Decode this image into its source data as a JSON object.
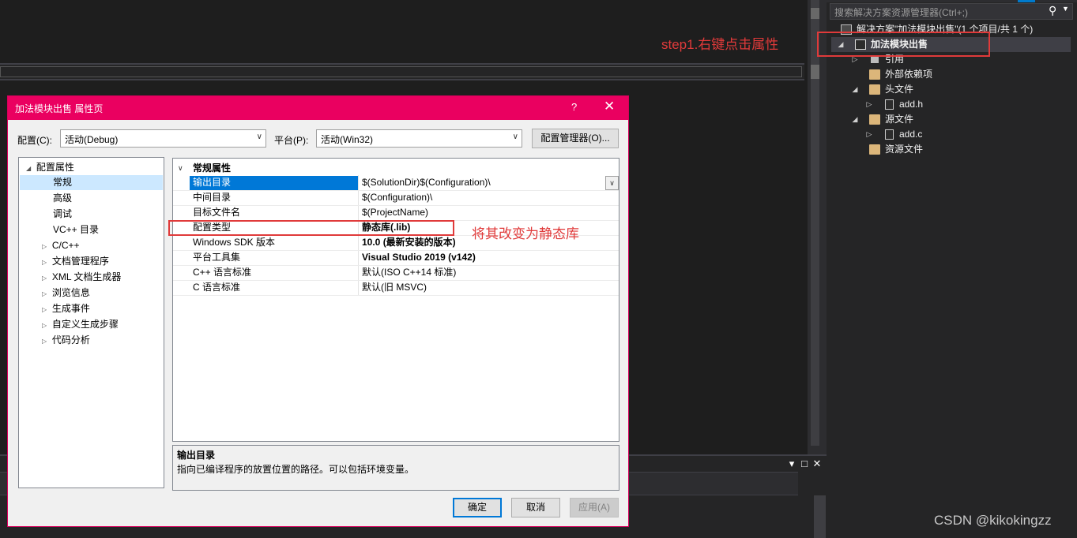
{
  "solution_explorer": {
    "search_placeholder": "搜索解决方案资源管理器(Ctrl+;)",
    "items": [
      {
        "label": "解决方案\"加法模块出售\"(1 个项目/共 1 个)"
      },
      {
        "label": "加法模块出售"
      },
      {
        "label": "引用"
      },
      {
        "label": "外部依赖项"
      },
      {
        "label": "头文件"
      },
      {
        "label": "add.h"
      },
      {
        "label": "源文件"
      },
      {
        "label": "add.c"
      },
      {
        "label": "资源文件"
      }
    ]
  },
  "annotations": {
    "step1": "step1.右键点击属性",
    "change": "将其改变为静态库"
  },
  "watermark": "CSDN @kikokingzz",
  "panel_buttons": {
    "dropdown": "▾",
    "maximize": "□",
    "close": "✕"
  },
  "dialog": {
    "title": "加法模块出售 属性页",
    "help": "?",
    "close": "✕",
    "config_label": "配置(C):",
    "config_value": "活动(Debug)",
    "platform_label": "平台(P):",
    "platform_value": "活动(Win32)",
    "config_manager": "配置管理器(O)...",
    "tree": [
      "配置属性",
      "常规",
      "高级",
      "调试",
      "VC++ 目录",
      "C/C++",
      "文档管理程序",
      "XML 文档生成器",
      "浏览信息",
      "生成事件",
      "自定义生成步骤",
      "代码分析"
    ],
    "grid_category": "常规属性",
    "grid_rows": [
      {
        "name": "输出目录",
        "value": "$(SolutionDir)$(Configuration)\\"
      },
      {
        "name": "中间目录",
        "value": "$(Configuration)\\"
      },
      {
        "name": "目标文件名",
        "value": "$(ProjectName)"
      },
      {
        "name": "配置类型",
        "value": "静态库(.lib)"
      },
      {
        "name": "Windows SDK 版本",
        "value": "10.0 (最新安装的版本)"
      },
      {
        "name": "平台工具集",
        "value": "Visual Studio 2019 (v142)"
      },
      {
        "name": "C++ 语言标准",
        "value": "默认(ISO C++14 标准)"
      },
      {
        "name": "C 语言标准",
        "value": "默认(旧 MSVC)"
      }
    ],
    "desc_title": "输出目录",
    "desc_text": "指向已编译程序的放置位置的路径。可以包括环境变量。",
    "ok": "确定",
    "cancel": "取消",
    "apply": "应用(A)"
  }
}
